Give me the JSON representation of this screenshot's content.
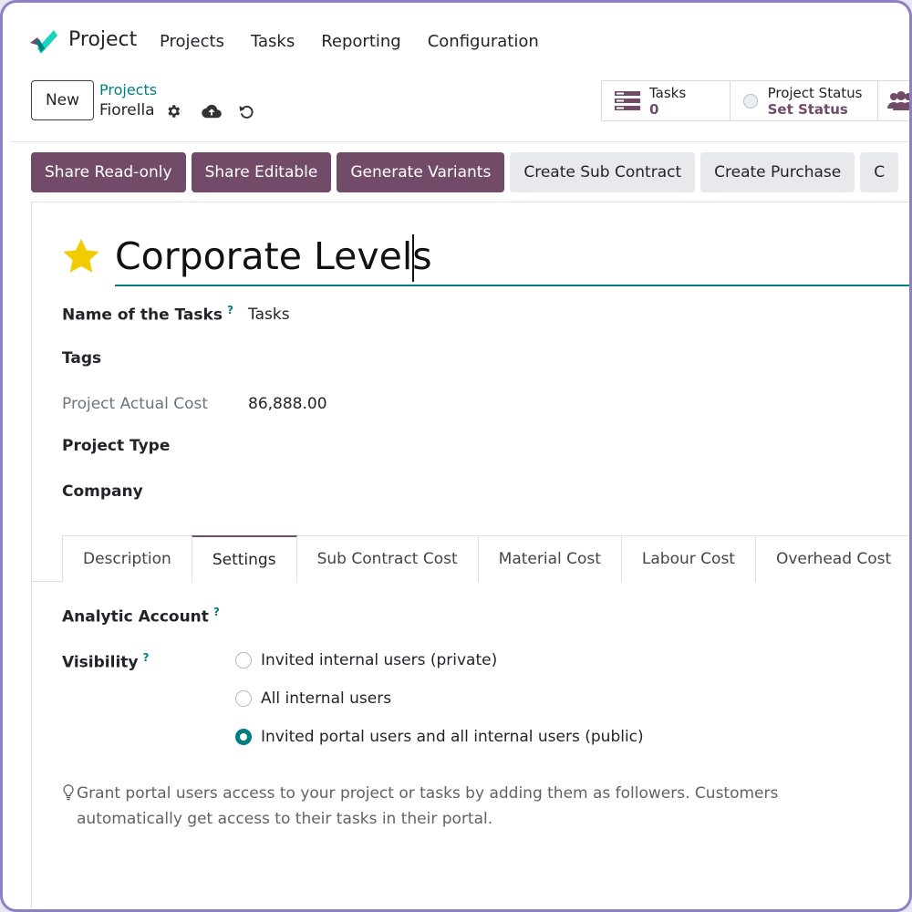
{
  "app": {
    "name": "Project"
  },
  "nav": {
    "items": [
      "Projects",
      "Tasks",
      "Reporting",
      "Configuration"
    ]
  },
  "control_panel": {
    "new_label": "New",
    "breadcrumb_parent": "Projects",
    "breadcrumb_current": "Fiorella"
  },
  "stats": {
    "tasks_label": "Tasks",
    "tasks_value": "0",
    "status_label": "Project Status",
    "status_value": "Set Status"
  },
  "actions": {
    "primary": [
      "Share Read-only",
      "Share Editable",
      "Generate Variants"
    ],
    "secondary": [
      "Create Sub Contract",
      "Create Purchase",
      "C"
    ]
  },
  "record": {
    "title": "Corporate Levels",
    "fields": {
      "task_name_label": "Name of the Tasks",
      "task_name_value": "Tasks",
      "tags_label": "Tags",
      "actual_cost_label": "Project Actual Cost",
      "actual_cost_value": "86,888.00",
      "project_type_label": "Project Type",
      "company_label": "Company"
    }
  },
  "tabs": [
    "Description",
    "Settings",
    "Sub Contract Cost",
    "Material Cost",
    "Labour Cost",
    "Overhead Cost"
  ],
  "active_tab": "Settings",
  "settings": {
    "analytic_label": "Analytic Account",
    "visibility_label": "Visibility",
    "help_mark": "?",
    "options": [
      "Invited internal users (private)",
      "All internal users",
      "Invited portal users and all internal users (public)"
    ],
    "selected_option": 2,
    "hint_line1": "Grant portal users access to your project or tasks by adding them as followers. Customers",
    "hint_line2": "automatically get access to their tasks in their portal."
  },
  "colors": {
    "brand": "#714b67",
    "accent": "#017e84",
    "star": "#f3cc00"
  },
  "icons": [
    "project-logo-icon",
    "gear-icon",
    "cloud-upload-icon",
    "undo-icon",
    "tasks-list-icon",
    "status-circle-icon",
    "users-icon",
    "star-icon",
    "lightbulb-icon"
  ]
}
